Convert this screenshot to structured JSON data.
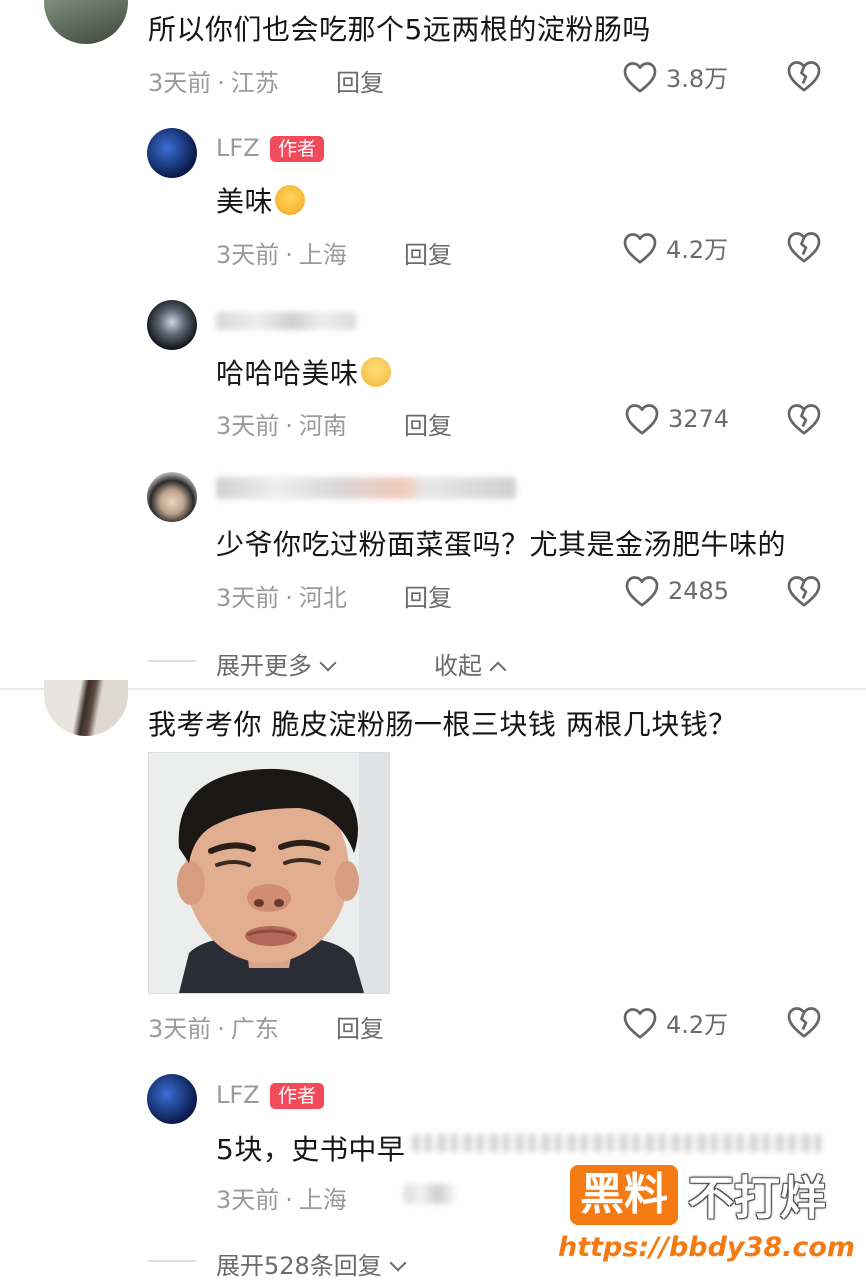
{
  "comments": [
    {
      "text": "所以你们也会吃那个5远两根的淀粉肠吗",
      "time": "3天前",
      "location": "江苏",
      "reply": "回复",
      "likes": "3.8万",
      "replies": [
        {
          "user": "LFZ",
          "badge": "作者",
          "text": "美味",
          "time": "3天前",
          "location": "上海",
          "reply": "回复",
          "likes": "4.2万"
        },
        {
          "user": "",
          "text": "哈哈哈美味",
          "time": "3天前",
          "location": "河南",
          "reply": "回复",
          "likes": "3274"
        },
        {
          "user": "",
          "text": "少爷你吃过粉面菜蛋吗？尤其是金汤肥牛味的",
          "time": "3天前",
          "location": "河北",
          "reply": "回复",
          "likes": "2485"
        }
      ],
      "expand_more": "展开更多",
      "collapse": "收起"
    },
    {
      "text": "我考考你 脆皮淀粉肠一根三块钱 两根几块钱？",
      "time": "3天前",
      "location": "广东",
      "reply": "回复",
      "likes": "4.2万",
      "replies": [
        {
          "user": "LFZ",
          "badge": "作者",
          "text": "5块，史书中早",
          "time": "3天前",
          "location": "上海"
        }
      ],
      "expand_more": "展开528条回复"
    }
  ],
  "watermark": {
    "brand_left": "黑料",
    "brand_right": "不打烊",
    "url": "https://bbdy38.com"
  },
  "colors": {
    "badge": "#f04a5b",
    "watermark_orange": "#f47a13"
  }
}
